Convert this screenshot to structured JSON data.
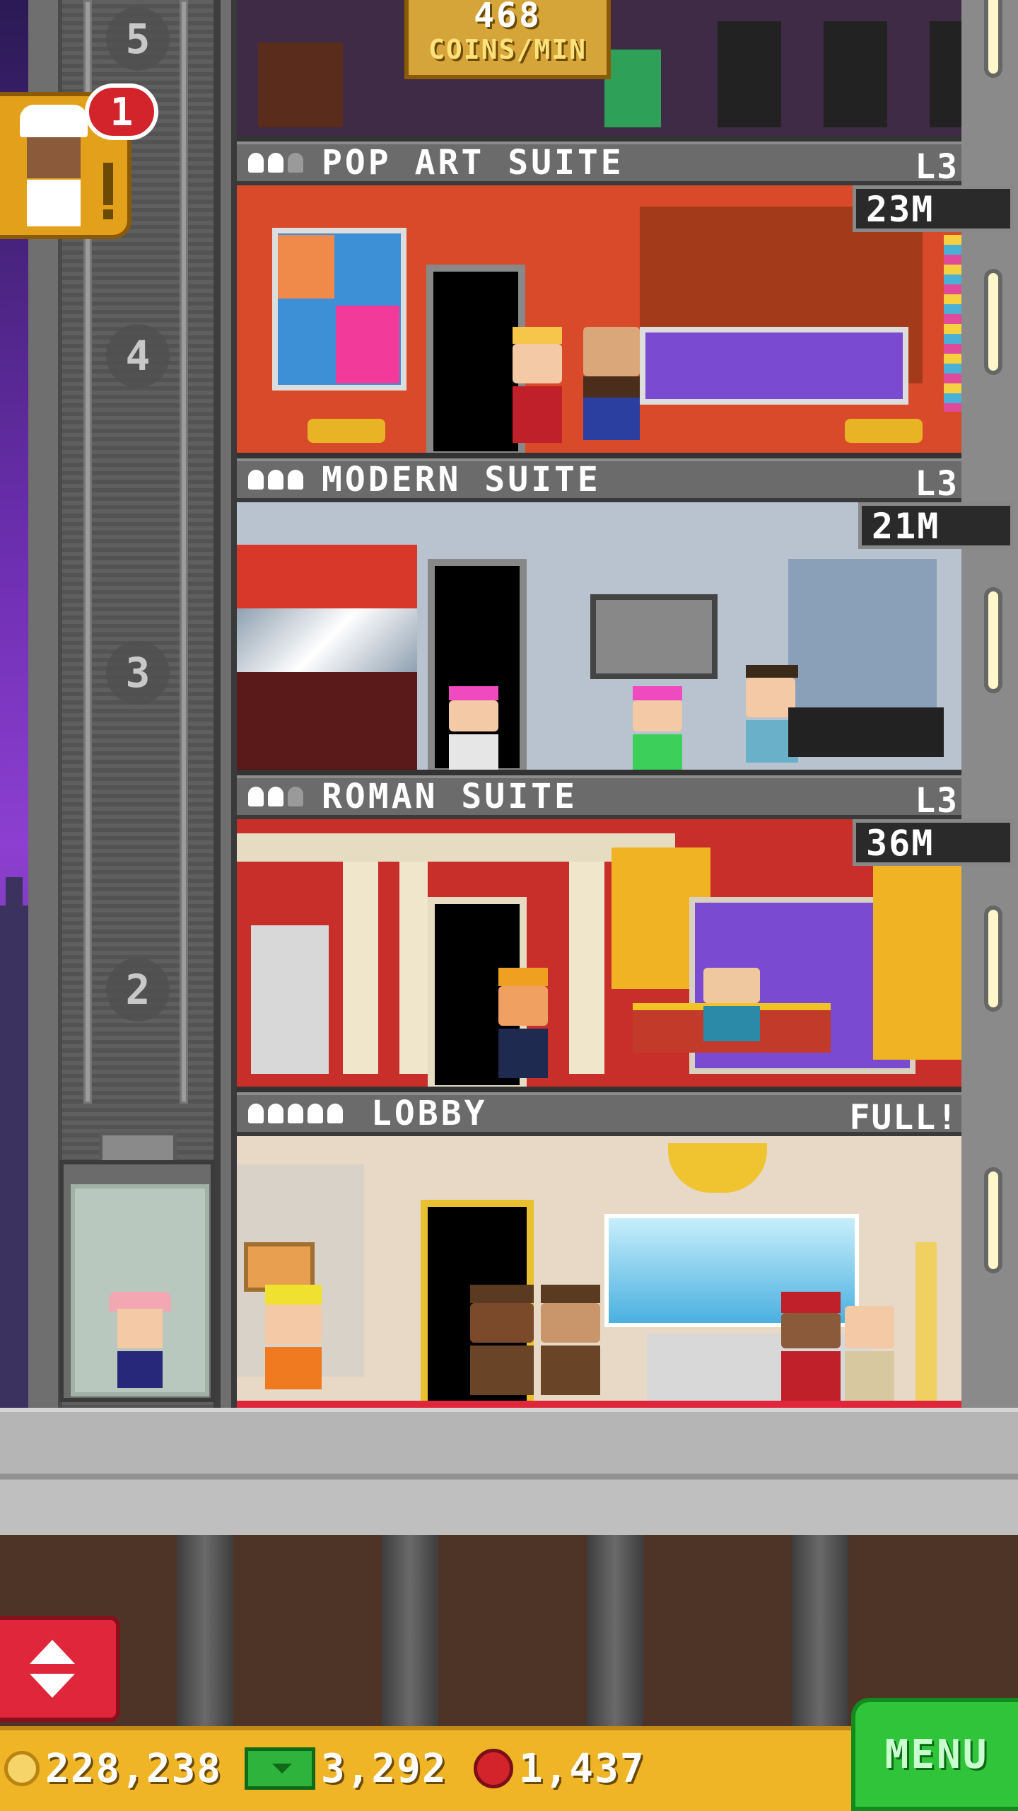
{
  "top_floor": {
    "coin_rate_value": "468",
    "coin_rate_unit": "COINS/MIN"
  },
  "notification": {
    "count": "1"
  },
  "elevator": {
    "floor_labels": [
      "5",
      "4",
      "3",
      "2"
    ]
  },
  "floors": [
    {
      "name": "POP ART SUITE",
      "level": "L3",
      "price": "23M",
      "residents": 2,
      "capacity": 3,
      "wall_color": "#d94a2a"
    },
    {
      "name": "MODERN SUITE",
      "level": "L3",
      "price": "21M",
      "residents": 3,
      "capacity": 3,
      "wall_color": "#b9c3cf"
    },
    {
      "name": "ROMAN SUITE",
      "level": "L3",
      "price": "36M",
      "residents": 2,
      "capacity": 3,
      "wall_color": "#c92f2a"
    },
    {
      "name": "LOBBY",
      "level": "FULL!",
      "residents": 5,
      "capacity": 5,
      "wall_color": "#e7d9c6"
    }
  ],
  "status_bar": {
    "coins": "228,238",
    "cash": "3,292",
    "bux": "1,437",
    "menu_label": "MENU"
  },
  "colors": {
    "status_bar": "#f0b527",
    "menu_button": "#2fc43a",
    "elevator_button": "#e0263a",
    "badge": "#d3232b"
  }
}
